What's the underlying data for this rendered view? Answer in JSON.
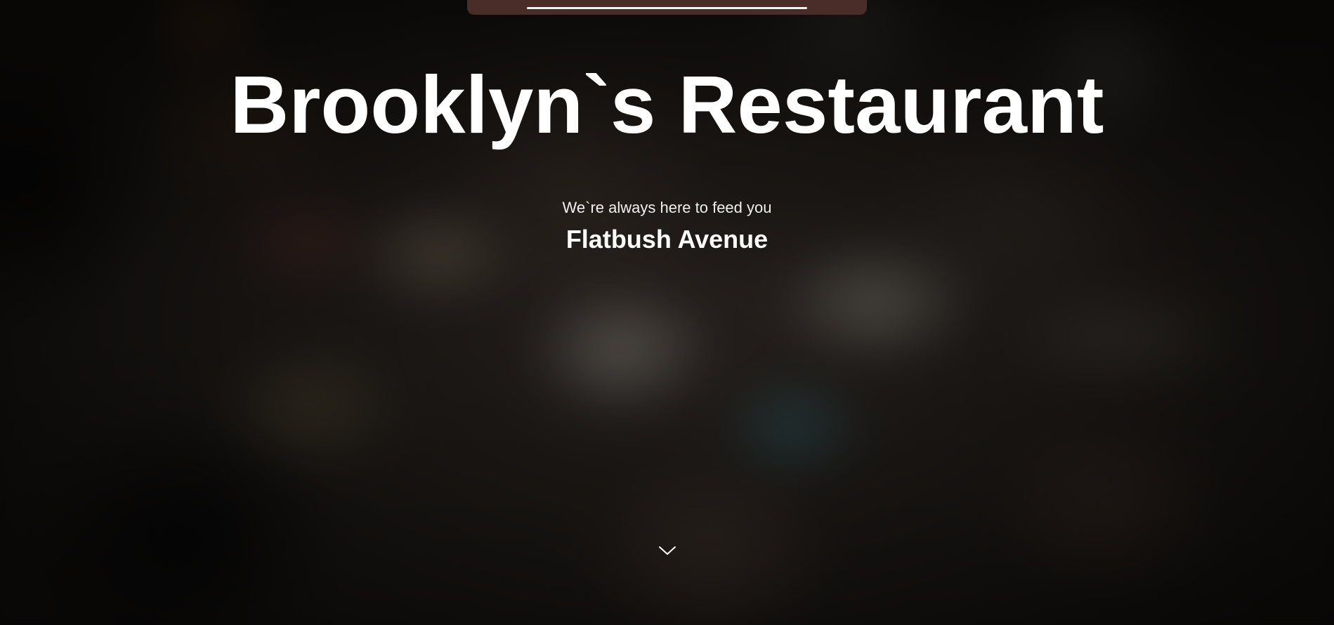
{
  "hero": {
    "title": "Brooklyn`s Restaurant",
    "tagline": "We`re always here to feed you",
    "location": "Flatbush Avenue",
    "scroll_icon": "chevron-down-icon"
  },
  "colors": {
    "top_bar": "#4a2d28",
    "text": "#ffffff"
  }
}
